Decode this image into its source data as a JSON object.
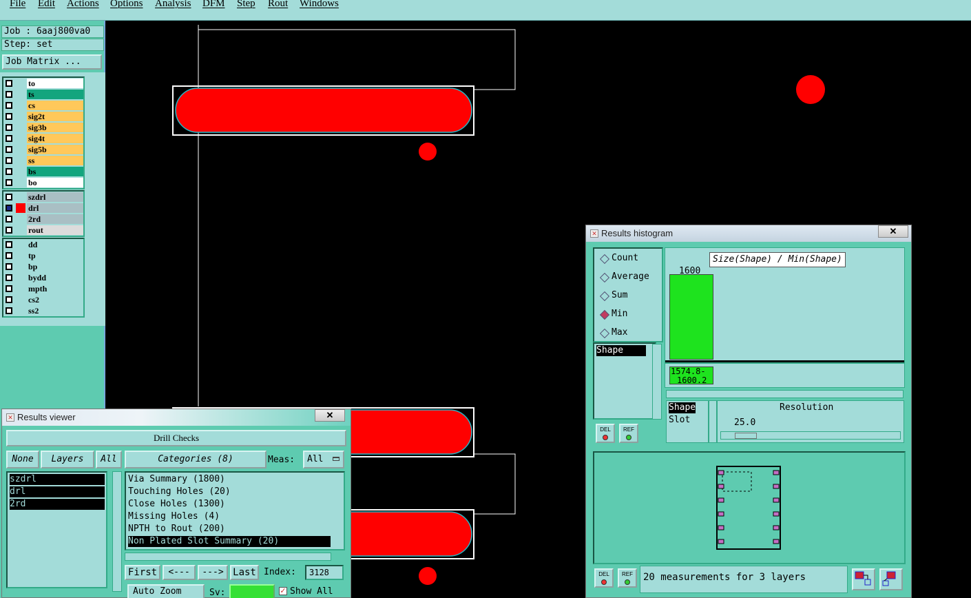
{
  "menubar": {
    "items": [
      "File",
      "Edit",
      "Actions",
      "Options",
      "Analysis",
      "DFM",
      "Step",
      "Rout",
      "Windows"
    ]
  },
  "left_panel": {
    "job_label": "Job : 6aaj800va0",
    "step_label": "Step: set",
    "job_matrix_button": "Job Matrix ...",
    "layer_groups": [
      [
        {
          "name": "to",
          "color": "#ffffff"
        },
        {
          "name": "ts",
          "color": "#13a57e"
        },
        {
          "name": "cs",
          "color": "#ffc85a"
        },
        {
          "name": "sig2t",
          "color": "#ffc85a"
        },
        {
          "name": "sig3b",
          "color": "#ffc85a"
        },
        {
          "name": "sig4t",
          "color": "#ffc85a"
        },
        {
          "name": "sig5b",
          "color": "#ffc85a"
        },
        {
          "name": "ss",
          "color": "#ffc85a"
        },
        {
          "name": "bs",
          "color": "#13a57e"
        },
        {
          "name": "bo",
          "color": "#ffffff"
        }
      ],
      [
        {
          "name": "szdrl",
          "color": "#a9bfc4"
        },
        {
          "name": "drl",
          "color": "#a9bfc4",
          "active": true
        },
        {
          "name": "2rd",
          "color": "#a9bfc4"
        },
        {
          "name": "rout",
          "color": "#dcdcdc"
        }
      ],
      [
        {
          "name": "dd",
          "color": "#a3dcd9"
        },
        {
          "name": "tp",
          "color": "#a3dcd9"
        },
        {
          "name": "bp",
          "color": "#a3dcd9"
        },
        {
          "name": "bydd",
          "color": "#a3dcd9"
        },
        {
          "name": "mpth",
          "color": "#a3dcd9"
        },
        {
          "name": "cs2",
          "color": "#a3dcd9"
        },
        {
          "name": "ss2",
          "color": "#a3dcd9"
        }
      ]
    ]
  },
  "results_viewer": {
    "title": "Results viewer",
    "close": "✕",
    "header": "Drill Checks",
    "none_btn": "None",
    "layers_btn": "Layers",
    "all_btn": "All",
    "categories_btn": "Categories (8)",
    "meas_label": "Meas:",
    "meas_value": "All",
    "layers": [
      "szdrl",
      "drl",
      "2rd"
    ],
    "categories": [
      "Via Summary (1800)",
      "Touching Holes (20)",
      "Close Holes (1300)",
      "Missing Holes (4)",
      "NPTH to Rout (200)",
      "Non Plated Slot Summary (20)"
    ],
    "selected_category": "Non Plated Slot Summary (20)",
    "first_btn": "First",
    "prev_btn": "<---",
    "next_btn": "--->",
    "last_btn": "Last",
    "index_label": "Index:",
    "index_value": "3128",
    "auto_zoom": "Auto Zoom",
    "sv_label": "Sv:",
    "show_all": "Show All"
  },
  "results_histogram": {
    "title": "Results histogram",
    "close": "✕",
    "modes": [
      {
        "label": "Count",
        "selected": false
      },
      {
        "label": "Average",
        "selected": false
      },
      {
        "label": "Sum",
        "selected": false
      },
      {
        "label": "Min",
        "selected": true
      },
      {
        "label": "Max",
        "selected": false
      }
    ],
    "attr_list": [
      "Shape"
    ],
    "chart_title": "Size(Shape) / Min(Shape)",
    "bar_value_label": "1600",
    "bar_range_label_1": "1574.8-",
    "bar_range_label_2": "1600.2",
    "bar_color": "#1ee31e",
    "bar_fraction": 1.0,
    "shape_list": [
      "Shape",
      "Slot"
    ],
    "resolution_label": "Resolution",
    "resolution_value": "25.0",
    "del_label": "DEL",
    "ref_label": "REF",
    "status": "20 measurements for 3 layers"
  }
}
